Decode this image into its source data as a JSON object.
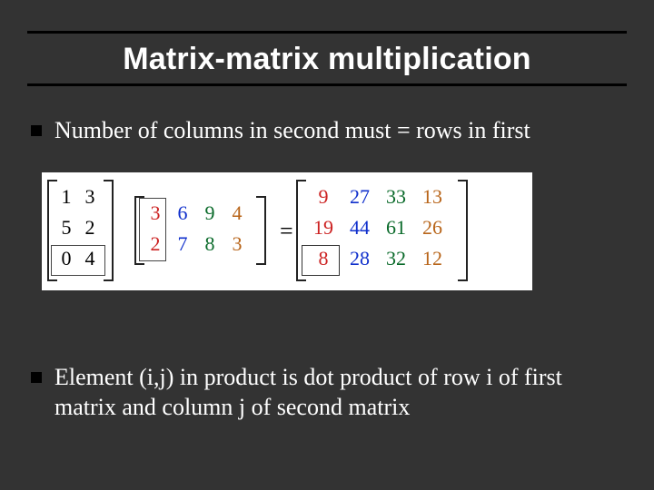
{
  "title": "Matrix-matrix multiplication",
  "bullets": {
    "b1": "Number of columns in second must  = rows in first",
    "b2": "Element (i,j) in product is dot product of row i of first matrix and column j of second matrix"
  },
  "equals": "=",
  "matrixA": {
    "a11": "1",
    "a12": "3",
    "a21": "5",
    "a22": "2",
    "a31": "0",
    "a32": "4"
  },
  "matrixB": {
    "b11": "3",
    "b12": "6",
    "b13": "9",
    "b14": "4",
    "b21": "2",
    "b22": "7",
    "b23": "8",
    "b24": "3"
  },
  "matrixC": {
    "c11": "9",
    "c12": "27",
    "c13": "33",
    "c14": "13",
    "c21": "19",
    "c22": "44",
    "c23": "61",
    "c24": "26",
    "c31": "8",
    "c32": "28",
    "c33": "32",
    "c34": "12"
  },
  "chart_data": {
    "type": "table",
    "title": "Matrix-matrix multiplication example",
    "A": [
      [
        1,
        3
      ],
      [
        5,
        2
      ],
      [
        0,
        4
      ]
    ],
    "B": [
      [
        3,
        6,
        9,
        4
      ],
      [
        2,
        7,
        8,
        3
      ]
    ],
    "C": [
      [
        9,
        27,
        33,
        13
      ],
      [
        19,
        44,
        61,
        26
      ],
      [
        8,
        28,
        32,
        12
      ]
    ],
    "highlight": {
      "A_row": 3,
      "B_col": 1,
      "C_cell": [
        3,
        1
      ]
    }
  }
}
